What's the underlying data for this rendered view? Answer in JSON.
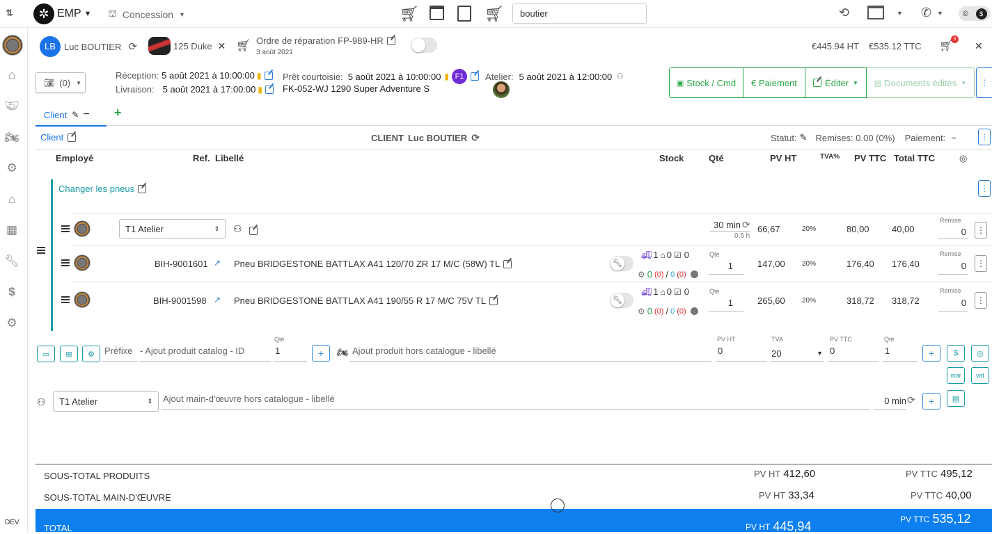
{
  "topbar": {
    "brand": "EMP",
    "concession": "Concession",
    "search_value": "boutier",
    "icons": [
      "cart-icon",
      "calendar-moto-icon",
      "clipboard-edit-icon",
      "cart-moto-icon"
    ]
  },
  "order": {
    "client_initials": "LB",
    "client_name": "Luc BOUTIER",
    "vehicle": "125 Duke",
    "title": "Ordre de réparation FP-989-HR",
    "date": "3 août 2021",
    "total_ht": "€445.94 HT",
    "total_ttc": "€535.12 TTC",
    "cart_count": "3"
  },
  "info": {
    "photos": "(0)",
    "reception_label": "Réception:",
    "reception_value": "5 août 2021 à 10:00:00",
    "livraison_label": "Livraison:",
    "livraison_value": "5 août 2021 à 17:00:00",
    "pret_label": "Prêt courtoisie:",
    "pret_value": "5 août 2021 à 10:00:00",
    "pret_badge": "F1",
    "pret_vehicle": "FK-052-WJ 1290 Super Adventure S",
    "atelier_label": "Atelier:",
    "atelier_value": "5 août 2021 à 12:00:00"
  },
  "actions": {
    "stock": "Stock / Cmd",
    "paiement": "€ Paiement",
    "editer": "Éditer",
    "documents": "Documents édités"
  },
  "tabs": {
    "client": "Client"
  },
  "client_section": {
    "link": "Client",
    "center_label": "CLIENT",
    "center_name": "Luc BOUTIER",
    "statut": "Statut:",
    "remises": "Remises: 0.00 (0%)",
    "paiement": "Paiement:"
  },
  "columns": {
    "employe": "Employé",
    "ref": "Ref.",
    "libelle": "Libellé",
    "stock": "Stock",
    "qte": "Qté",
    "pvht": "PV HT",
    "tva": "TVA%",
    "pvttc": "PV TTC",
    "totalttc": "Total TTC"
  },
  "group": {
    "title": "Changer les pneus",
    "labor": {
      "atelier": "T1 Atelier",
      "duration": "30 min",
      "hours": "0.5 h",
      "pvht": "66,67",
      "tva": "20%",
      "pvttc": "80,00",
      "total": "40,00",
      "remise_label": "Remise",
      "remise": "0"
    },
    "products": [
      {
        "ref": "BIH-9001601",
        "libelle": "Pneu BRIDGESTONE BATTLAX A41 120/70 ZR 17 M/C (58W) TL",
        "stock_truck": "1",
        "stock_garage": "0",
        "stock_check": "0",
        "stock_a": "0",
        "stock_b": "(0)",
        "stock_c": "0",
        "stock_d": "(0)",
        "qte_label": "Qté",
        "qte": "1",
        "pvht": "147,00",
        "tva": "20%",
        "pvttc": "176,40",
        "total": "176,40",
        "remise_label": "Remise",
        "remise": "0"
      },
      {
        "ref": "BIH-9001598",
        "libelle": "Pneu BRIDGESTONE BATTLAX A41 190/55 R 17 M/C 75V TL",
        "stock_truck": "1",
        "stock_garage": "0",
        "stock_check": "0",
        "stock_a": "0",
        "stock_b": "(0)",
        "stock_c": "0",
        "stock_d": "(0)",
        "qte_label": "Qté",
        "qte": "1",
        "pvht": "265,60",
        "tva": "20%",
        "pvttc": "318,72",
        "total": "318,72",
        "remise_label": "Remise",
        "remise": "0"
      }
    ]
  },
  "add_product": {
    "prefix_placeholder": "Préfixe",
    "catalog_placeholder": "- Ajout produit catalog - ID",
    "qte_label": "Qté",
    "qte": "1",
    "hors_placeholder": "Ajout produit hors catalogue - libellé",
    "pvht_label": "PV HT",
    "pvht": "0",
    "tva_label": "TVA",
    "tva": "20",
    "pvttc_label": "PV TTC",
    "pvttc": "0",
    "qte2_label": "Qté",
    "qte2": "1",
    "mar": "mar",
    "vat": "vat"
  },
  "add_labor": {
    "atelier": "T1 Atelier",
    "placeholder": "Ajout main-d'œuvre hors catalogue - libellé",
    "duration": "0 min"
  },
  "totals": {
    "products_label": "SOUS-TOTAL PRODUITS",
    "products_ht_label": "PV HT",
    "products_ht": "412,60",
    "products_ttc_label": "PV TTC",
    "products_ttc": "495,12",
    "labor_label": "SOUS-TOTAL MAIN-D'ŒUVRE",
    "labor_ht_label": "PV HT",
    "labor_ht": "33,34",
    "labor_ttc_label": "PV TTC",
    "labor_ttc": "40,00",
    "total_label": "TOTAL",
    "total_ht_label": "PV HT",
    "total_ht": "445,94",
    "total_ttc_label": "PV TTC",
    "total_ttc": "535,12"
  },
  "env": "DEV",
  "colors": {
    "primary": "#0d7fef",
    "success": "#28a745",
    "teal": "#1a9ba6",
    "purple": "#6f3dd6"
  }
}
